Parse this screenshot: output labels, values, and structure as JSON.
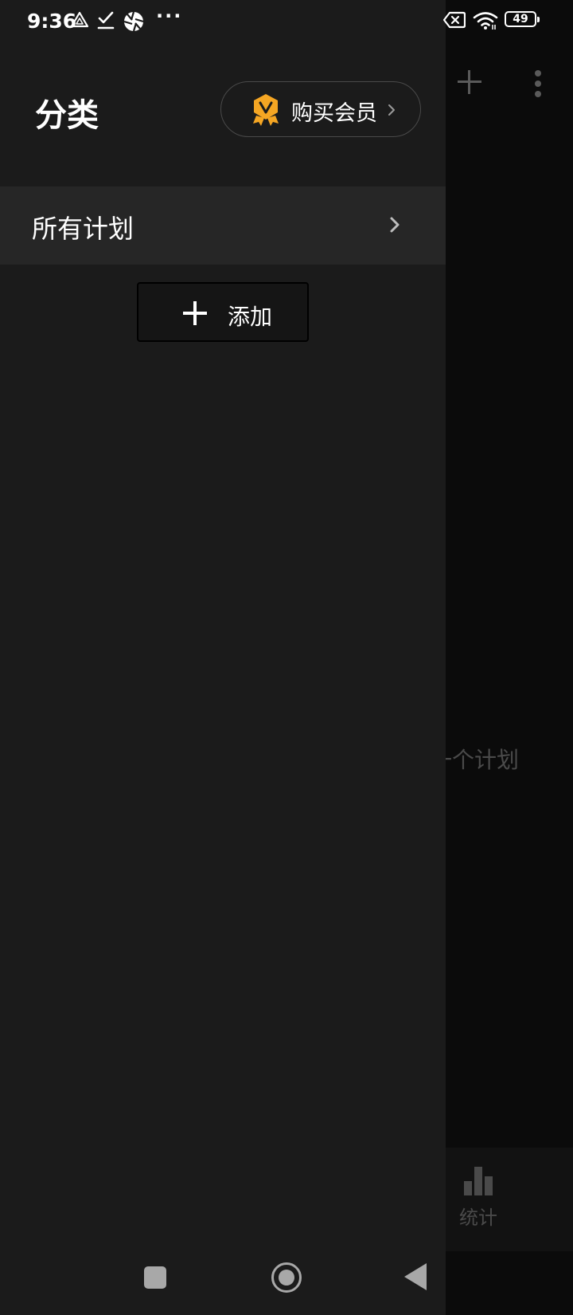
{
  "status_bar": {
    "time": "9:36",
    "icons_left": [
      "drive-icon",
      "check-download-icon",
      "aperture-icon",
      "more-dots-icon"
    ],
    "more_dots": "···",
    "icons_right": [
      "sim-off-icon",
      "wifi-icon",
      "battery-icon"
    ],
    "battery_level": "49"
  },
  "drawer": {
    "title": "分类",
    "vip_button": {
      "label": "购买会员",
      "badge_icon": "vip-badge-icon",
      "badge_color": "#f5a623"
    },
    "categories": [
      {
        "label": "所有计划"
      }
    ],
    "add_button": {
      "label": "添加"
    }
  },
  "background": {
    "empty_text": "一个计划",
    "bottom_tab": {
      "label": "统计",
      "icon": "bar-chart-icon"
    }
  },
  "colors": {
    "drawer_bg": "#1b1b1b",
    "item_bg": "#262626",
    "screen_bg": "#0b0b0b",
    "accent": "#f5a623"
  }
}
